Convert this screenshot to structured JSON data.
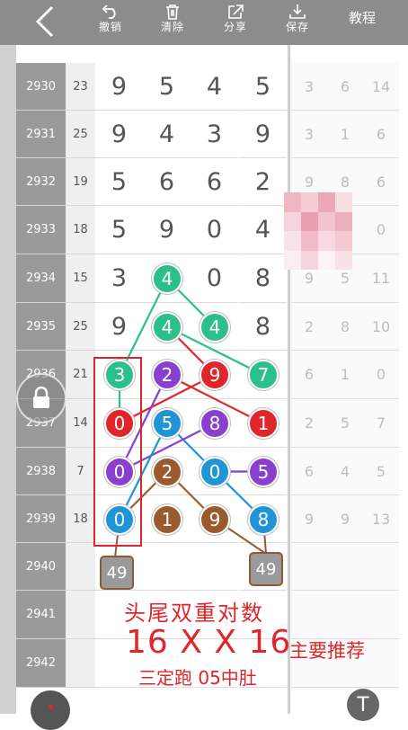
{
  "toolbar": {
    "undo": "撤销",
    "clear": "清除",
    "share": "分享",
    "save": "保存",
    "tutorial": "教程"
  },
  "rows": [
    {
      "issue": "2930",
      "sum": "23",
      "digits": [
        "9",
        "5",
        "4",
        "5"
      ],
      "right": [
        "3",
        "6",
        "14"
      ]
    },
    {
      "issue": "2931",
      "sum": "25",
      "digits": [
        "9",
        "4",
        "3",
        "9"
      ],
      "right": [
        "3",
        "1",
        "6"
      ]
    },
    {
      "issue": "2932",
      "sum": "19",
      "digits": [
        "5",
        "6",
        "6",
        "2"
      ],
      "right": [
        "9",
        "8",
        "6"
      ]
    },
    {
      "issue": "2933",
      "sum": "18",
      "digits": [
        "5",
        "9",
        "0",
        "4"
      ],
      "right": [
        "",
        "",
        "0"
      ]
    },
    {
      "issue": "2934",
      "sum": "15",
      "digits": [
        "3",
        "",
        "0",
        "8"
      ],
      "right": [
        "9",
        "5",
        "11"
      ]
    },
    {
      "issue": "2935",
      "sum": "25",
      "digits": [
        "9",
        "",
        "",
        "8"
      ],
      "right": [
        "2",
        "8",
        "10"
      ]
    },
    {
      "issue": "2936",
      "sum": "21",
      "digits": [
        "",
        "",
        "",
        ""
      ],
      "right": [
        "6",
        "1",
        "0"
      ]
    },
    {
      "issue": "2937",
      "sum": "14",
      "digits": [
        "",
        "",
        "",
        ""
      ],
      "right": [
        "2",
        "5",
        "7"
      ]
    },
    {
      "issue": "2938",
      "sum": "7",
      "digits": [
        "",
        "",
        "",
        ""
      ],
      "right": [
        "6",
        "4",
        "5"
      ]
    },
    {
      "issue": "2939",
      "sum": "18",
      "digits": [
        "",
        "",
        "",
        ""
      ],
      "right": [
        "9",
        "9",
        "13"
      ]
    },
    {
      "issue": "2940",
      "sum": "",
      "digits": [
        "",
        "",
        "",
        ""
      ],
      "right": [
        "",
        "",
        ""
      ]
    },
    {
      "issue": "2941",
      "sum": "",
      "digits": [
        "",
        "",
        "",
        ""
      ],
      "right": [
        "",
        "",
        ""
      ]
    },
    {
      "issue": "2942",
      "sum": "",
      "digits": [
        "",
        "",
        "",
        ""
      ],
      "right": [
        "",
        "",
        ""
      ]
    }
  ],
  "balls": [
    {
      "row": 4,
      "col": 1,
      "value": "4",
      "color": "#2bbf8a"
    },
    {
      "row": 5,
      "col": 1,
      "value": "4",
      "color": "#2bbf8a"
    },
    {
      "row": 5,
      "col": 2,
      "value": "4",
      "color": "#2bbf8a"
    },
    {
      "row": 6,
      "col": 0,
      "value": "3",
      "color": "#2bbf8a"
    },
    {
      "row": 6,
      "col": 1,
      "value": "2",
      "color": "#8b3fd1"
    },
    {
      "row": 6,
      "col": 2,
      "value": "9",
      "color": "#e0262b"
    },
    {
      "row": 6,
      "col": 3,
      "value": "7",
      "color": "#2bbf8a"
    },
    {
      "row": 7,
      "col": 0,
      "value": "0",
      "color": "#e0262b"
    },
    {
      "row": 7,
      "col": 1,
      "value": "5",
      "color": "#1f95d6"
    },
    {
      "row": 7,
      "col": 2,
      "value": "8",
      "color": "#8b3fd1"
    },
    {
      "row": 7,
      "col": 3,
      "value": "1",
      "color": "#e0262b"
    },
    {
      "row": 8,
      "col": 0,
      "value": "0",
      "color": "#8b3fd1"
    },
    {
      "row": 8,
      "col": 1,
      "value": "2",
      "color": "#9b5a2e"
    },
    {
      "row": 8,
      "col": 2,
      "value": "0",
      "color": "#1f95d6"
    },
    {
      "row": 8,
      "col": 3,
      "value": "5",
      "color": "#8b3fd1"
    },
    {
      "row": 9,
      "col": 0,
      "value": "0",
      "color": "#1f95d6"
    },
    {
      "row": 9,
      "col": 1,
      "value": "1",
      "color": "#9b5a2e"
    },
    {
      "row": 9,
      "col": 2,
      "value": "9",
      "color": "#9b5a2e"
    },
    {
      "row": 9,
      "col": 3,
      "value": "8",
      "color": "#1f95d6"
    }
  ],
  "lines": [
    {
      "from": [
        4,
        1
      ],
      "to": [
        5,
        2
      ],
      "color": "#2bbf8a"
    },
    {
      "from": [
        4,
        1
      ],
      "to": [
        6,
        0
      ],
      "color": "#2bbf8a"
    },
    {
      "from": [
        5,
        1
      ],
      "to": [
        6,
        3
      ],
      "color": "#2bbf8a"
    },
    {
      "from": [
        5,
        1
      ],
      "to": [
        6,
        2
      ],
      "color": "#e0262b"
    },
    {
      "from": [
        6,
        0
      ],
      "to": [
        7,
        0
      ],
      "color": "#2bbf8a"
    },
    {
      "from": [
        6,
        2
      ],
      "to": [
        7,
        0
      ],
      "color": "#e0262b"
    },
    {
      "from": [
        6,
        1
      ],
      "to": [
        7,
        3
      ],
      "color": "#e0262b"
    },
    {
      "from": [
        6,
        1
      ],
      "to": [
        8,
        0
      ],
      "color": "#8b3fd1"
    },
    {
      "from": [
        7,
        1
      ],
      "to": [
        8,
        2
      ],
      "color": "#1f95d6"
    },
    {
      "from": [
        7,
        2
      ],
      "to": [
        8,
        0
      ],
      "color": "#8b3fd1"
    },
    {
      "from": [
        7,
        1
      ],
      "to": [
        9,
        0
      ],
      "color": "#1f95d6"
    },
    {
      "from": [
        8,
        1
      ],
      "to": [
        9,
        2
      ],
      "color": "#9b5a2e"
    },
    {
      "from": [
        8,
        1
      ],
      "to": [
        9,
        0
      ],
      "color": "#9b5a2e"
    },
    {
      "from": [
        8,
        2
      ],
      "to": [
        8,
        3
      ],
      "color": "#8b3fd1"
    },
    {
      "from": [
        8,
        2
      ],
      "to": [
        9,
        3
      ],
      "color": "#1f95d6"
    }
  ],
  "badges": {
    "left": "49",
    "right": "49"
  },
  "annotation": {
    "line1": "头尾双重对数",
    "line2": "16 X X 16",
    "line3": "主要推荐",
    "line4": "三定跑 05中肚"
  },
  "floating": {
    "t_button": "T"
  }
}
